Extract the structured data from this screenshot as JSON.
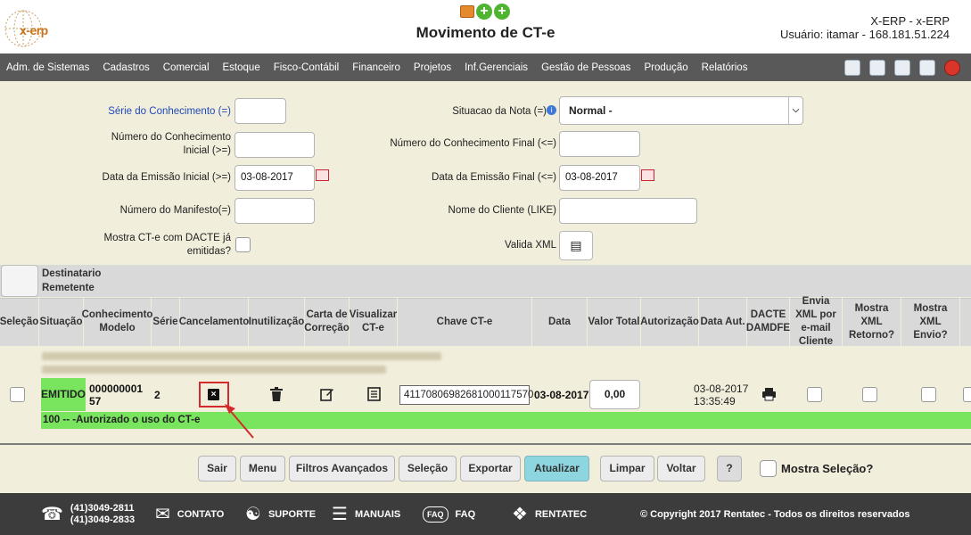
{
  "app": {
    "logo_text": "x-erp",
    "title": "Movimento de CT-e",
    "system": "X-ERP - x-ERP",
    "user": "Usuário: itamar - 168.181.51.224"
  },
  "menu": [
    "Adm. de Sistemas",
    "Cadastros",
    "Comercial",
    "Estoque",
    "Fisco-Contábil",
    "Financeiro",
    "Projetos",
    "Inf.Gerenciais",
    "Gestão de Pessoas",
    "Produção",
    "Relatórios"
  ],
  "filters": {
    "serie_label": "Série do Conhecimento (=)",
    "serie_value": "",
    "numero_inicial_label": "Número do Conhecimento Inicial (>=)",
    "numero_inicial_value": "",
    "data_inicial_label": "Data da Emissão Inicial (>=)",
    "data_inicial_value": "03-08-2017",
    "manifesto_label": "Número do Manifesto(=)",
    "manifesto_value": "",
    "mostra_dacte_label": "Mostra CT-e com DACTE já emitidas?",
    "situacao_label": "Situacao da Nota (=)",
    "situacao_value": "Normal -",
    "numero_final_label": "Número do Conhecimento Final (<=)",
    "numero_final_value": "",
    "data_final_label": "Data da Emissão Final (<=)",
    "data_final_value": "03-08-2017",
    "cliente_label": "Nome do Cliente (LIKE)",
    "cliente_value": "",
    "valida_xml_label": "Valida XML"
  },
  "grid": {
    "group_header_1": "Destinatario",
    "group_header_2": "Remetente",
    "columns": [
      "Seleção",
      "Situação",
      "Conhecimento Modelo",
      "Série",
      "Cancelamento",
      "Inutilização",
      "Carta de Correção",
      "Visualizar CT-e",
      "Chave CT-e",
      "Data",
      "Valor Total",
      "Autorização",
      "Data Aut.",
      "DACTE DAMDFE",
      "Envia XML por e-mail Cliente",
      "Mostra XML Retorno?",
      "Mostra XML Envio?"
    ],
    "row": {
      "situacao": "EMITIDO",
      "conhecimento_line1": "000000001",
      "conhecimento_line2": "57",
      "serie": "2",
      "chave": "41170806982681000117570",
      "data": "03-08-2017",
      "valor_total": "0,00",
      "data_aut_1": "03-08-2017",
      "data_aut_2": "13:35:49",
      "status_message": "100 -- -Autorizado o uso do CT-e"
    }
  },
  "buttons": {
    "sair": "Sair",
    "menu": "Menu",
    "filtros": "Filtros Avançados",
    "selecao": "Seleção",
    "exportar": "Exportar",
    "atualizar": "Atualizar",
    "limpar": "Limpar",
    "voltar": "Voltar",
    "help": "?",
    "mostra_selecao": "Mostra Seleção?"
  },
  "footer": {
    "phone1": "(41)3049-2811",
    "phone2": "(41)3049-2833",
    "contato": "CONTATO",
    "suporte": "SUPORTE",
    "manuais": "MANUAIS",
    "faq": "FAQ",
    "faq_badge": "FAQ",
    "rentatec": "RENTATEC",
    "copyright": "© Copyright 2017 Rentatec - Todos os direitos reservados"
  },
  "colors": {
    "menubar": "#595959",
    "status_green": "#79e45e",
    "highlight_red": "#d32b2b",
    "primary_button": "#8dd6df"
  }
}
